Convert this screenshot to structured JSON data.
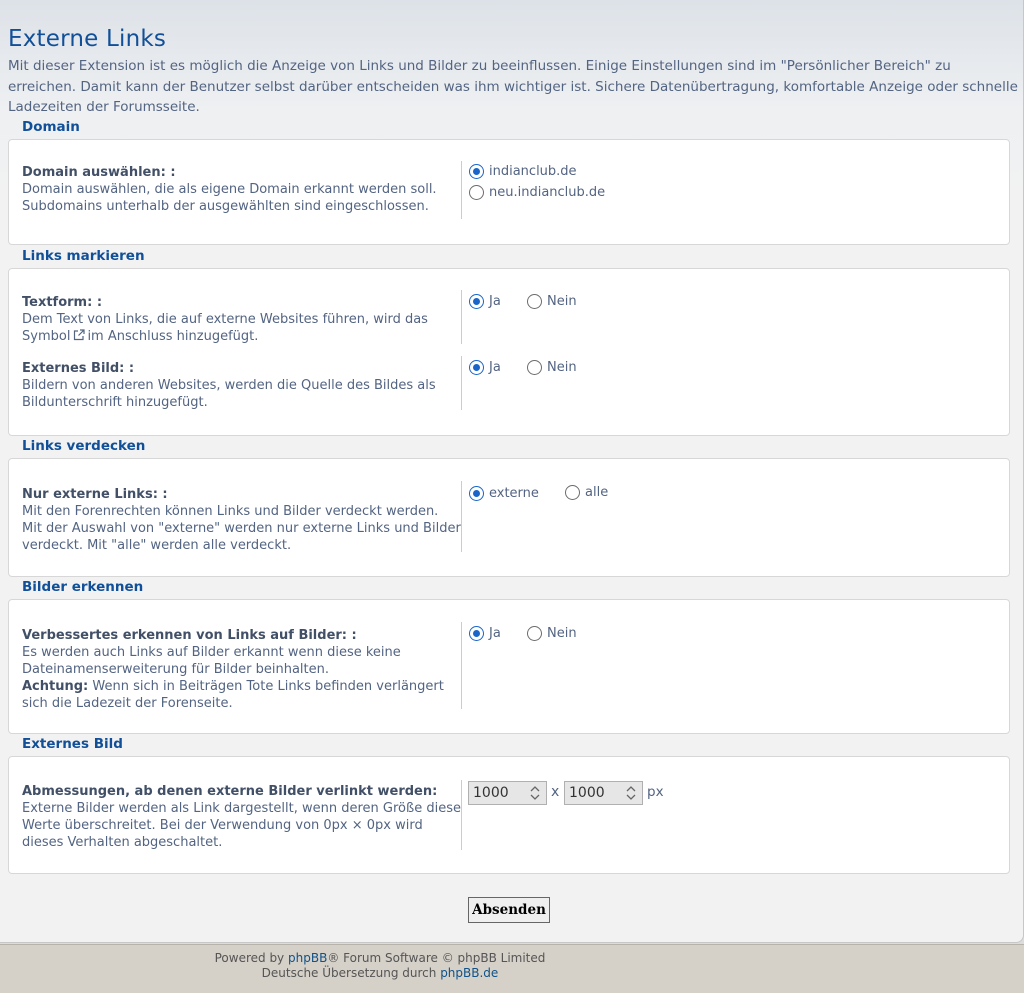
{
  "page": {
    "title": "Externe Links",
    "intro": "Mit dieser Extension ist es möglich die Anzeige von Links und Bilder zu beeinflussen. Einige Einstellungen sind im \"Persönlicher Bereich\" zu erreichen. Damit kann der Benutzer selbst darüber entscheiden was ihm wichtiger ist. Sichere Datenübertragung, komfortable Anzeige oder schnelle Ladezeiten der Forumsseite."
  },
  "domain": {
    "legend": "Domain",
    "label": "Domain auswählen: :",
    "explain": "Domain auswählen, die als eigene Domain erkannt werden soll. Subdomains unterhalb der ausgewählten sind eingeschlossen.",
    "options": [
      {
        "label": "indianclub.de",
        "checked": true
      },
      {
        "label": "neu.indianclub.de",
        "checked": false
      }
    ]
  },
  "mark": {
    "legend": "Links markieren",
    "text": {
      "label": "Textform: :",
      "explain_before": "Dem Text von Links, die auf externe Websites führen, wird das Symbol",
      "explain_after": "im Anschluss hinzugefügt.",
      "icon": "external-link-icon",
      "yes": "Ja",
      "no": "Nein",
      "value": "Ja"
    },
    "image": {
      "label": "Externes Bild: :",
      "explain": "Bildern von anderen Websites, werden die Quelle des Bildes als Bildunterschrift hinzugefügt.",
      "yes": "Ja",
      "no": "Nein",
      "value": "Ja"
    }
  },
  "hide": {
    "legend": "Links verdecken",
    "label": "Nur externe Links: :",
    "explain": "Mit den Forenrechten können Links und Bilder verdeckt werden. Mit der Auswahl von \"externe\" werden nur externe Links und Bilder verdeckt. Mit \"alle\" werden alle verdeckt.",
    "opt1": "externe",
    "opt2": "alle",
    "value": "externe"
  },
  "detect": {
    "legend": "Bilder erkennen",
    "label": "Verbessertes erkennen von Links auf Bilder: :",
    "explain": "Es werden auch Links auf Bilder erkannt wenn diese keine Dateinamenserweiterung für Bilder beinhalten.",
    "warn_label": "Achtung:",
    "warn_text": "Wenn sich in Beiträgen Tote Links befinden verlängert sich die Ladezeit der Forenseite.",
    "yes": "Ja",
    "no": "Nein",
    "value": "Ja"
  },
  "extimg": {
    "legend": "Externes Bild",
    "label": "Abmessungen, ab denen externe Bilder verlinkt werden:",
    "explain": "Externe Bilder werden als Link dargestellt, wenn deren Größe diese Werte überschreitet. Bei der Verwendung von 0px × 0px wird dieses Verhalten abgeschaltet.",
    "width": "1000",
    "times": "x",
    "height": "1000",
    "unit": "px"
  },
  "submit_label": "Absenden",
  "footer": {
    "powered_prefix": "Powered by",
    "phpbb_link": "phpBB",
    "powered_suffix": "® Forum Software © phpBB Limited",
    "translation_prefix": "Deutsche Übersetzung durch",
    "translation_link": "phpBB.de"
  }
}
